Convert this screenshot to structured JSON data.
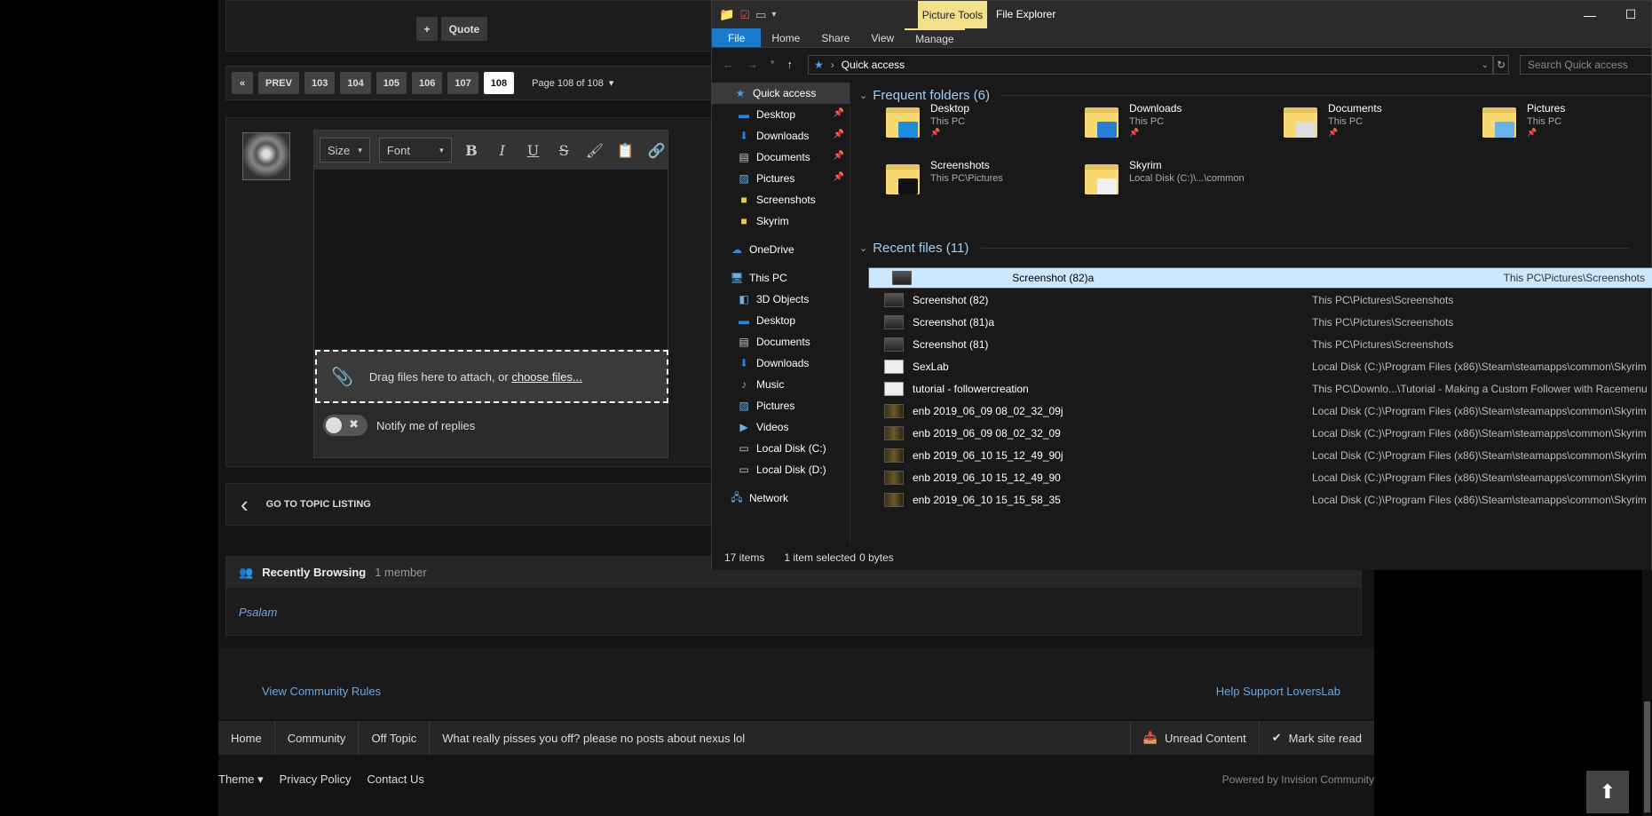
{
  "forum": {
    "plus_label": "+",
    "quote_label": "Quote",
    "pagination": {
      "first": "«",
      "prev": "PREV",
      "pages": [
        "103",
        "104",
        "105",
        "106",
        "107",
        "108"
      ],
      "active": "108",
      "page_label": "Page 108 of 108"
    },
    "editor": {
      "size_label": "Size",
      "font_label": "Font",
      "dropzone_text": "Drag files here to attach, or",
      "dropzone_link": "choose files...",
      "notify_label": "Notify me of replies",
      "toggle_x": "✖"
    },
    "go_to_topic": "GO TO TOPIC LISTING",
    "recently_browsing": {
      "title": "Recently Browsing",
      "count": "1 member",
      "members": [
        "Psalam"
      ]
    },
    "footer": {
      "community_rules": "View Community Rules",
      "help_support": "Help Support LoversLab"
    },
    "breadcrumbs": [
      "Home",
      "Community",
      "Off Topic",
      "What really pisses you off? please no posts about nexus lol"
    ],
    "unread_content": "Unread Content",
    "mark_site_read": "Mark site read",
    "theme": "Theme",
    "privacy_policy": "Privacy Policy",
    "contact_us": "Contact Us",
    "powered_by": "Powered by Invision Community"
  },
  "explorer": {
    "picture_tools": "Picture Tools",
    "title": "File Explorer",
    "ribbon_tabs": [
      "File",
      "Home",
      "Share",
      "View",
      "Manage"
    ],
    "address": "Quick access",
    "search_placeholder": "Search Quick access",
    "nav": {
      "quick_access": "Quick access",
      "pinned": [
        "Desktop",
        "Downloads",
        "Documents",
        "Pictures"
      ],
      "quick_other": [
        "Screenshots",
        "Skyrim"
      ],
      "onedrive": "OneDrive",
      "this_pc": "This PC",
      "pc_items": [
        "3D Objects",
        "Desktop",
        "Documents",
        "Downloads",
        "Music",
        "Pictures",
        "Videos",
        "Local Disk (C:)",
        "Local Disk (D:)"
      ],
      "network": "Network"
    },
    "frequent_header": "Frequent folders (6)",
    "frequent": [
      {
        "name": "Desktop",
        "location": "This PC",
        "pinned": true,
        "badge_color": "#1f8ad6"
      },
      {
        "name": "Downloads",
        "location": "This PC",
        "pinned": true,
        "badge_color": "#2a7fd4"
      },
      {
        "name": "Documents",
        "location": "This PC",
        "pinned": true,
        "badge_color": "#dddddd"
      },
      {
        "name": "Pictures",
        "location": "This PC",
        "pinned": true,
        "badge_color": "#6bb0e8"
      },
      {
        "name": "Screenshots",
        "location": "This PC\\Pictures",
        "pinned": false,
        "badge_color": "#111111"
      },
      {
        "name": "Skyrim",
        "location": "Local Disk (C:)\\...\\common",
        "pinned": false,
        "badge_color": "#f0f0f0"
      }
    ],
    "pin_glyph": "📌",
    "recent_header": "Recent files (11)",
    "recent": [
      {
        "name": "Screenshot (82)a",
        "path": "This PC\\Pictures\\Screenshots",
        "icon": "img",
        "selected": true
      },
      {
        "name": "Screenshot (82)",
        "path": "This PC\\Pictures\\Screenshots",
        "icon": "img",
        "selected": false
      },
      {
        "name": "Screenshot (81)a",
        "path": "This PC\\Pictures\\Screenshots",
        "icon": "img",
        "selected": false
      },
      {
        "name": "Screenshot (81)",
        "path": "This PC\\Pictures\\Screenshots",
        "icon": "img",
        "selected": false
      },
      {
        "name": "SexLab",
        "path": "Local Disk (C:)\\Program Files (x86)\\Steam\\steamapps\\common\\Skyrim",
        "icon": "doc",
        "selected": false
      },
      {
        "name": "tutorial - followercreation",
        "path": "This PC\\Downlo...\\Tutorial - Making a Custom Follower with Racemenu",
        "icon": "doc",
        "selected": false
      },
      {
        "name": "enb 2019_06_09 08_02_32_09j",
        "path": "Local Disk (C:)\\Program Files (x86)\\Steam\\steamapps\\common\\Skyrim",
        "icon": "enb",
        "selected": false
      },
      {
        "name": "enb 2019_06_09 08_02_32_09",
        "path": "Local Disk (C:)\\Program Files (x86)\\Steam\\steamapps\\common\\Skyrim",
        "icon": "enb",
        "selected": false
      },
      {
        "name": "enb 2019_06_10 15_12_49_90j",
        "path": "Local Disk (C:)\\Program Files (x86)\\Steam\\steamapps\\common\\Skyrim",
        "icon": "enb",
        "selected": false
      },
      {
        "name": "enb 2019_06_10 15_12_49_90",
        "path": "Local Disk (C:)\\Program Files (x86)\\Steam\\steamapps\\common\\Skyrim",
        "icon": "enb",
        "selected": false
      },
      {
        "name": "enb 2019_06_10 15_15_58_35",
        "path": "Local Disk (C:)\\Program Files (x86)\\Steam\\steamapps\\common\\Skyrim",
        "icon": "enb",
        "selected": false
      }
    ],
    "status": {
      "items": "17 items",
      "selected": "1 item selected",
      "size": "0 bytes"
    }
  }
}
